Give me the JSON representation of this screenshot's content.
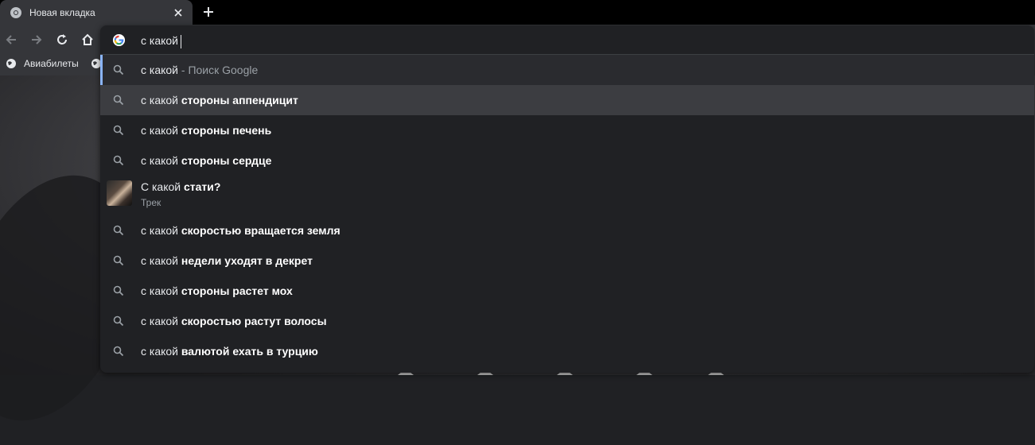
{
  "tabs": [
    {
      "title": "Новая вкладка"
    }
  ],
  "bookmarks": [
    {
      "label": "Авиабилеты"
    },
    {
      "label": ""
    }
  ],
  "omnibox": {
    "input_value": "с какой",
    "suggestions": [
      {
        "prefix": "с какой",
        "bold": "",
        "suffix": " - Поиск Google",
        "selected": true
      },
      {
        "prefix": "с какой",
        "bold": " стороны аппендицит",
        "hover": true
      },
      {
        "prefix": "с какой",
        "bold": " стороны печень"
      },
      {
        "prefix": "с какой",
        "bold": " стороны сердце"
      },
      {
        "prefix": "С какой",
        "bold": " стати?",
        "subtitle": "Трек",
        "type": "track"
      },
      {
        "prefix": "с какой",
        "bold": " скоростью вращается земля"
      },
      {
        "prefix": "с какой",
        "bold": " недели уходят в декрет"
      },
      {
        "prefix": "с какой",
        "bold": " стороны растет мох"
      },
      {
        "prefix": "с какой",
        "bold": " скоростью растут волосы"
      },
      {
        "prefix": "с какой",
        "bold": " валютой ехать в турцию"
      }
    ]
  },
  "colors": {
    "accent": "#8ab4f8",
    "background": "#202124",
    "toolbar": "#35363a"
  },
  "icons": [
    "chrome-icon",
    "close-icon",
    "plus-icon",
    "back-arrow-icon",
    "forward-arrow-icon",
    "reload-icon",
    "home-icon",
    "google-icon",
    "search-icon",
    "globe-icon"
  ]
}
